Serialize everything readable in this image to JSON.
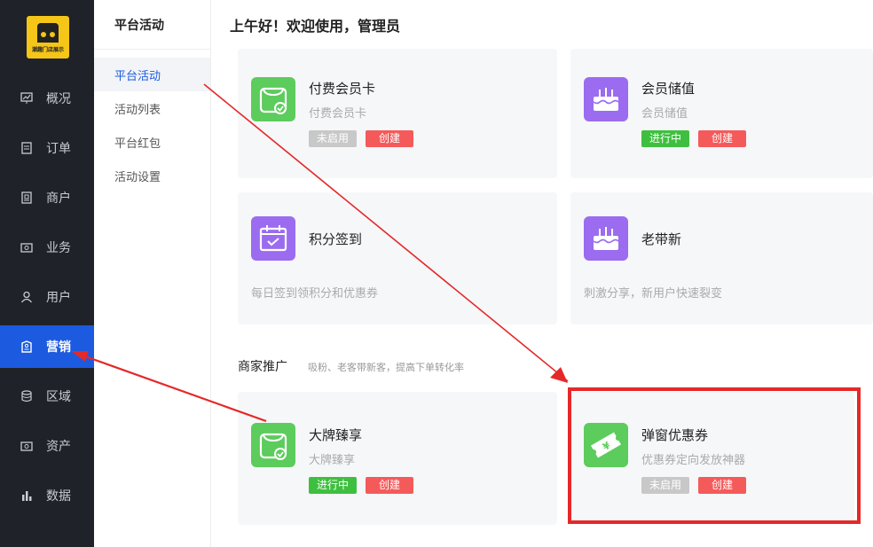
{
  "logo": {
    "text": "潮趣门店展示"
  },
  "sidebar": {
    "items": [
      {
        "label": "概况",
        "icon": "chart-icon"
      },
      {
        "label": "订单",
        "icon": "order-icon"
      },
      {
        "label": "商户",
        "icon": "merchant-icon"
      },
      {
        "label": "业务",
        "icon": "business-icon"
      },
      {
        "label": "用户",
        "icon": "user-icon"
      },
      {
        "label": "营销",
        "icon": "marketing-icon"
      },
      {
        "label": "区域",
        "icon": "region-icon"
      },
      {
        "label": "资产",
        "icon": "asset-icon"
      },
      {
        "label": "数据",
        "icon": "data-icon"
      }
    ]
  },
  "subnav": {
    "title": "平台活动",
    "items": [
      {
        "label": "平台活动"
      },
      {
        "label": "活动列表"
      },
      {
        "label": "平台红包"
      },
      {
        "label": "活动设置"
      }
    ]
  },
  "header": {
    "greeting": "上午好！欢迎使用，管理员"
  },
  "cards": {
    "paid_card": {
      "name": "付费会员卡",
      "desc": "付费会员卡",
      "status": "未启用",
      "action": "创建"
    },
    "stored_value": {
      "name": "会员储值",
      "desc": "会员储值",
      "status": "进行中",
      "action": "创建"
    },
    "checkin": {
      "name": "积分签到",
      "desc": "每日签到领积分和优惠券"
    },
    "referral": {
      "name": "老带新",
      "desc": "刺激分享，新用户快速裂变"
    },
    "brand": {
      "name": "大牌臻享",
      "desc": "大牌臻享",
      "status": "进行中",
      "action": "创建"
    },
    "popup_coupon": {
      "name": "弹窗优惠券",
      "desc": "优惠券定向发放神器",
      "status": "未启用",
      "action": "创建"
    }
  },
  "section": {
    "title": "商家推广",
    "subtitle": "吸粉、老客带新客，提高下单转化率"
  },
  "colors": {
    "sidebar_bg": "#1f2228",
    "accent": "#1c5ae0",
    "annotation": "#e52828",
    "green_icon": "#5ccc5c",
    "purple_icon": "#9b6cf0"
  }
}
